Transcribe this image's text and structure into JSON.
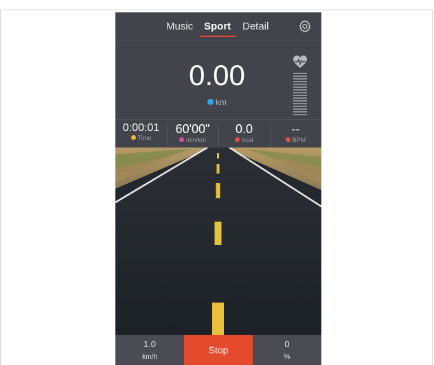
{
  "tabs": {
    "music": "Music",
    "sport": "Sport",
    "detail": "Detail"
  },
  "settings_icon": "gear-icon",
  "distance": {
    "value": "0.00",
    "unit": "km"
  },
  "heart_icon": "heart-rate-icon",
  "stats": [
    {
      "value": "0:00:01",
      "label": "Time",
      "dot_color": "#f3b533"
    },
    {
      "value": "60'00\"",
      "label": "min/km",
      "dot_color": "#d74fa8"
    },
    {
      "value": "0.0",
      "label": "kcal",
      "dot_color": "#e8503a"
    },
    {
      "value": "--",
      "label": "BPM",
      "dot_color": "#e8503a"
    }
  ],
  "controls": {
    "speed_value": "1.0",
    "speed_unit": "km/h",
    "stop_label": "Stop",
    "incline_value": "0",
    "incline_unit": "%"
  },
  "colors": {
    "accent": "#e44a2c",
    "panel": "#43444b",
    "distance_dot": "#2fa6e6"
  }
}
